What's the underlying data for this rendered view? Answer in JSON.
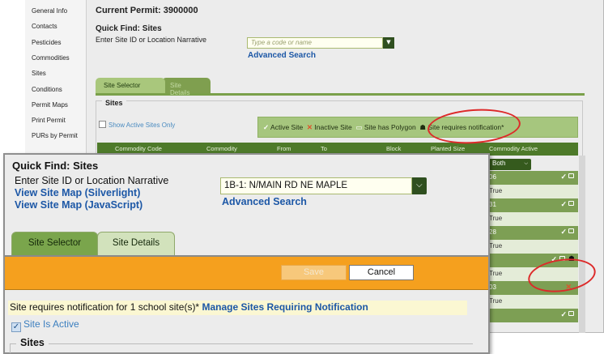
{
  "nav": [
    "General Info",
    "Contacts",
    "Pesticides",
    "Commodities",
    "Sites",
    "Conditions",
    "Permit Maps",
    "Print Permit",
    "PURs by Permit"
  ],
  "bg": {
    "permit": "Current Permit: 3900000",
    "quick_find_title": "Quick Find: Sites",
    "quick_find_label": "Enter Site ID or Location Narrative",
    "input_placeholder": "Type a code or name",
    "advanced_search": "Advanced Search",
    "tabs": [
      "Site Selector",
      "Site Details"
    ],
    "sites_legend": "Sites",
    "show_active_only": "Show Active Sites Only",
    "legend": {
      "active": "Active Site",
      "inactive": "Inactive Site",
      "polygon": "Site has Polygon",
      "notify": "Site requires notification*"
    },
    "columns": [
      "Commodity Code",
      "Commodity",
      "From",
      "To",
      "Block",
      "Planted Size",
      "Commodity Active"
    ],
    "filter": "Both",
    "col_rows": [
      {
        "text": "06",
        "style": "dark",
        "icons": "tick-poly"
      },
      {
        "text": "True",
        "style": "light",
        "icons": ""
      },
      {
        "text": "31",
        "style": "dark",
        "icons": "tick-poly"
      },
      {
        "text": "True",
        "style": "light",
        "icons": ""
      },
      {
        "text": "28",
        "style": "dark",
        "icons": "tick-poly"
      },
      {
        "text": "True",
        "style": "light",
        "icons": ""
      },
      {
        "text": "",
        "style": "dark",
        "icons": "tick-poly-house"
      },
      {
        "text": "True",
        "style": "light",
        "icons": ""
      },
      {
        "text": "03",
        "style": "dark",
        "icons": "x"
      },
      {
        "text": "True",
        "style": "light",
        "icons": ""
      },
      {
        "text": "",
        "style": "dark",
        "icons": "tick-poly"
      }
    ]
  },
  "fg": {
    "quick_find_title": "Quick Find: Sites",
    "quick_find_label": "Enter Site ID or Location Narrative",
    "view_map_silverlight": "View Site Map (Silverlight)",
    "view_map_js": "View Site Map (JavaScript)",
    "site_value": "1B-1: N/MAIN RD NE MAPLE",
    "advanced_search": "Advanced Search",
    "tabs": [
      "Site Selector",
      "Site Details"
    ],
    "save": "Save",
    "cancel": "Cancel",
    "notification_text": "Site requires notification for 1 school site(s)*",
    "notification_link": "Manage Sites Requiring Notification",
    "site_is_active": "Site Is Active",
    "sites_legend": "Sites"
  },
  "colors": {
    "green": "#7aa54c",
    "orange": "#f5a01e",
    "link": "#1c57a6",
    "annotation": "#dd2a2a"
  }
}
